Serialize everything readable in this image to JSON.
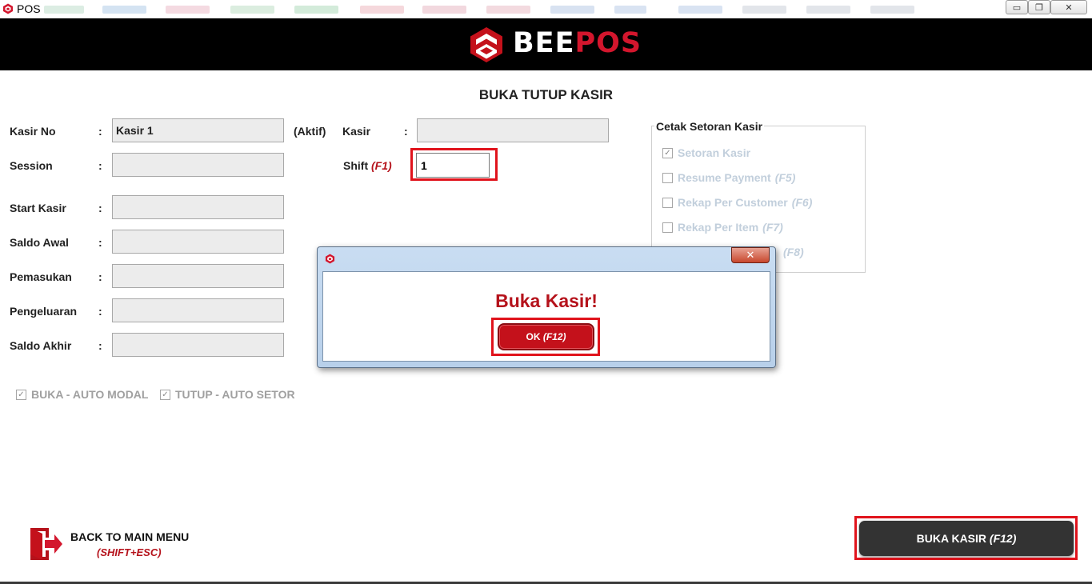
{
  "window": {
    "title": "POS",
    "minimize_glyph": "▭",
    "restore_glyph": "❐",
    "close_glyph": "✕"
  },
  "header": {
    "logo_part1": "BEE",
    "logo_part2": "POS"
  },
  "page_title": "BUKA TUTUP KASIR",
  "form": {
    "colon": ":",
    "kasir_no_label": "Kasir No",
    "kasir_no_value": "Kasir 1",
    "aktif_label": "(Aktif)",
    "kasir_label": "Kasir",
    "kasir_value": "",
    "session_label": "Session",
    "session_value": "",
    "shift_label": "Shift",
    "shift_key": "(F1)",
    "shift_value": "1",
    "start_kasir_label": "Start Kasir",
    "start_kasir_value": "",
    "saldo_awal_label": "Saldo Awal",
    "saldo_awal_value": "",
    "pemasukan_label": "Pemasukan",
    "pemasukan_value": "",
    "pengeluaran_label": "Pengeluaran",
    "pengeluaran_value": "",
    "saldo_akhir_label": "Saldo Akhir",
    "saldo_akhir_value": ""
  },
  "cetak_setoran": {
    "legend": "Cetak Setoran Kasir",
    "items": [
      {
        "label": "Setoran Kasir",
        "key": "",
        "checked": true
      },
      {
        "label": "Resume Payment",
        "key": "(F5)",
        "checked": false
      },
      {
        "label": "Rekap Per Customer",
        "key": "(F6)",
        "checked": false
      },
      {
        "label": "Rekap Per Item",
        "key": "(F7)",
        "checked": false
      },
      {
        "label": "",
        "key": "(F8)",
        "checked": false
      }
    ]
  },
  "auto_options": {
    "buka_label": "BUKA - AUTO MODAL",
    "buka_checked": true,
    "tutup_label": "TUTUP - AUTO SETOR",
    "tutup_checked": true
  },
  "dialog": {
    "message": "Buka Kasir!",
    "ok_label": "OK",
    "ok_key": "(F12)",
    "close_glyph": "✕"
  },
  "bottom": {
    "back_label": "BACK TO MAIN MENU",
    "back_shortcut": "(SHIFT+ESC)",
    "buka_label": "BUKA KASIR",
    "buka_key": "(F12)"
  },
  "colors": {
    "brand_red": "#d3162d",
    "highlight_red": "#e0131c",
    "dark_button": "#333333"
  },
  "icons": [
    "beepos-logo-icon",
    "door-exit-icon",
    "check-icon",
    "close-icon",
    "minimize-icon",
    "restore-icon"
  ]
}
